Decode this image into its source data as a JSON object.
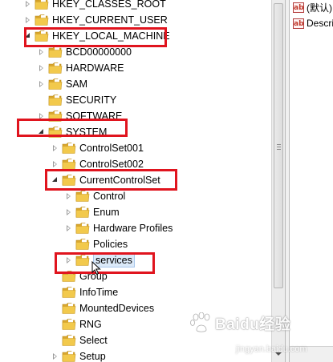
{
  "tree": {
    "nodes": [
      {
        "label": "HKEY_CLASSES_ROOT",
        "indent": 0,
        "expander": "closed"
      },
      {
        "label": "HKEY_CURRENT_USER",
        "indent": 0,
        "expander": "closed"
      },
      {
        "label": "HKEY_LOCAL_MACHINE",
        "indent": 0,
        "expander": "open"
      },
      {
        "label": "BCD00000000",
        "indent": 1,
        "expander": "closed"
      },
      {
        "label": "HARDWARE",
        "indent": 1,
        "expander": "closed"
      },
      {
        "label": "SAM",
        "indent": 1,
        "expander": "closed"
      },
      {
        "label": "SECURITY",
        "indent": 1,
        "expander": "none"
      },
      {
        "label": "SOFTWARE",
        "indent": 1,
        "expander": "closed"
      },
      {
        "label": "SYSTEM",
        "indent": 1,
        "expander": "open"
      },
      {
        "label": "ControlSet001",
        "indent": 2,
        "expander": "closed"
      },
      {
        "label": "ControlSet002",
        "indent": 2,
        "expander": "closed"
      },
      {
        "label": "CurrentControlSet",
        "indent": 2,
        "expander": "open"
      },
      {
        "label": "Control",
        "indent": 3,
        "expander": "closed"
      },
      {
        "label": "Enum",
        "indent": 3,
        "expander": "closed"
      },
      {
        "label": "Hardware Profiles",
        "indent": 3,
        "expander": "closed"
      },
      {
        "label": "Policies",
        "indent": 3,
        "expander": "none"
      },
      {
        "label": "services",
        "indent": 3,
        "expander": "closed",
        "selected": true
      },
      {
        "label": "Group",
        "indent": 2,
        "expander": "none"
      },
      {
        "label": "InfoTime",
        "indent": 2,
        "expander": "none"
      },
      {
        "label": "MountedDevices",
        "indent": 2,
        "expander": "none"
      },
      {
        "label": "RNG",
        "indent": 2,
        "expander": "none"
      },
      {
        "label": "Select",
        "indent": 2,
        "expander": "none"
      },
      {
        "label": "Setup",
        "indent": 2,
        "expander": "closed"
      }
    ]
  },
  "values_pane": {
    "items": [
      {
        "icon": "string-value-icon",
        "icon_text": "ab",
        "name": "(默认)"
      },
      {
        "icon": "string-value-icon",
        "icon_text": "ab",
        "name": "Description"
      }
    ]
  },
  "watermark": {
    "brand": "Baidu经验",
    "sub": "经验",
    "url": "jingyan.baidu.com"
  },
  "colors": {
    "highlight": "#e0141e",
    "folder": "#f2c94c",
    "selection": "#dbe9f8"
  }
}
